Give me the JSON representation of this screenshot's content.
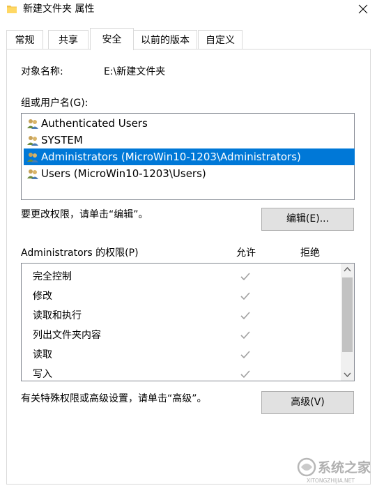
{
  "window": {
    "title": "新建文件夹 属性",
    "close_glyph": "✕"
  },
  "tabs": [
    {
      "label": "常规",
      "active": false
    },
    {
      "label": "共享",
      "active": false
    },
    {
      "label": "安全",
      "active": true
    },
    {
      "label": "以前的版本",
      "active": false
    },
    {
      "label": "自定义",
      "active": false
    }
  ],
  "security": {
    "object_name_label": "对象名称:",
    "object_name_value": "E:\\新建文件夹",
    "groups_label": "组或用户名(G):",
    "groups": [
      {
        "name": "Authenticated Users",
        "icon": "users-group-icon",
        "selected": false
      },
      {
        "name": "SYSTEM",
        "icon": "users-group-icon",
        "selected": false
      },
      {
        "name": "Administrators (MicroWin10-1203\\Administrators)",
        "icon": "users-group-icon",
        "selected": true
      },
      {
        "name": "Users (MicroWin10-1203\\Users)",
        "icon": "users-group-icon",
        "selected": false
      }
    ],
    "change_hint": "要更改权限，请单击“编辑”。",
    "edit_button": "编辑(E)...",
    "permissions_label": "Administrators 的权限(P)",
    "allow_header": "允许",
    "deny_header": "拒绝",
    "permissions": [
      {
        "name": "完全控制",
        "allow": true,
        "deny": false
      },
      {
        "name": "修改",
        "allow": true,
        "deny": false
      },
      {
        "name": "读取和执行",
        "allow": true,
        "deny": false
      },
      {
        "name": "列出文件夹内容",
        "allow": true,
        "deny": false
      },
      {
        "name": "读取",
        "allow": true,
        "deny": false
      },
      {
        "name": "写入",
        "allow": true,
        "deny": false
      }
    ],
    "advanced_hint": "有关特殊权限或高级设置，请单击“高级”。",
    "advanced_button": "高级(V)"
  },
  "colors": {
    "selection": "#0078d7",
    "check": "#a0a0a0",
    "folder": "#f0c24a"
  },
  "watermark": {
    "text": "系统之家",
    "subtext": "XITONGZHIJIA.NET"
  }
}
